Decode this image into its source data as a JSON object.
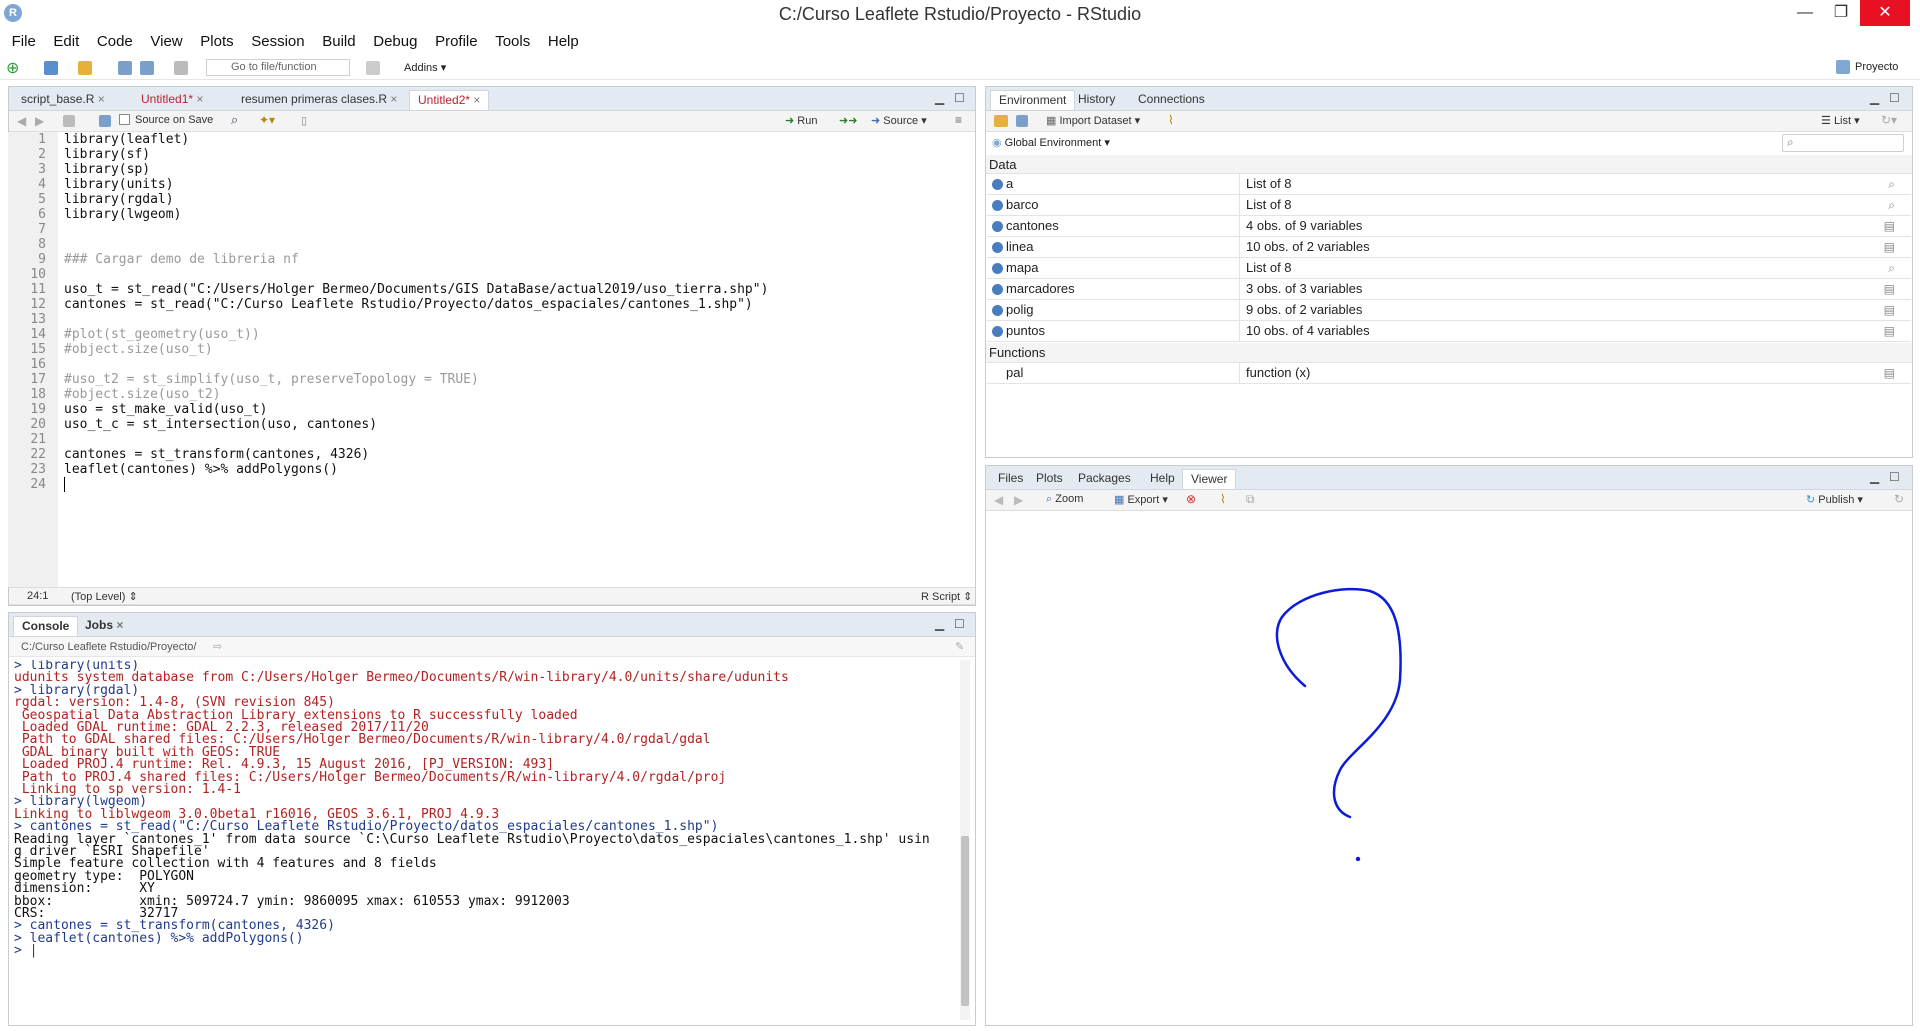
{
  "window": {
    "title": "C:/Curso Leaflete Rstudio/Proyecto - RStudio",
    "logo": "R",
    "min": "—",
    "max": "❐",
    "close": "✕"
  },
  "menu": [
    "File",
    "Edit",
    "Code",
    "View",
    "Plots",
    "Session",
    "Build",
    "Debug",
    "Profile",
    "Tools",
    "Help"
  ],
  "toolbar": {
    "goto_placeholder": "Go to file/function",
    "addins": "Addins",
    "project": "Proyecto"
  },
  "editor": {
    "tabs": [
      "script_base.R",
      "Untitled1*",
      "resumen primeras clases.R",
      "Untitled2*"
    ],
    "source_on_save": "Source on Save",
    "run": "Run",
    "source": "Source",
    "lines": [
      {
        "n": "1",
        "t": "library(leaflet)",
        "k": "code"
      },
      {
        "n": "2",
        "t": "library(sf)",
        "k": "code"
      },
      {
        "n": "3",
        "t": "library(sp)",
        "k": "code"
      },
      {
        "n": "4",
        "t": "library(units)",
        "k": "code"
      },
      {
        "n": "5",
        "t": "library(rgdal)",
        "k": "code"
      },
      {
        "n": "6",
        "t": "library(lwgeom)",
        "k": "code"
      },
      {
        "n": "7",
        "t": "",
        "k": "code"
      },
      {
        "n": "8",
        "t": "",
        "k": "code"
      },
      {
        "n": "9",
        "t": "### Cargar demo de libreria nf",
        "k": "cmt"
      },
      {
        "n": "10",
        "t": "",
        "k": "code"
      },
      {
        "n": "11",
        "t": "uso_t = st_read(\"C:/Users/Holger Bermeo/Documents/GIS DataBase/actual2019/uso_tierra.shp\")",
        "k": "code"
      },
      {
        "n": "12",
        "t": "cantones = st_read(\"C:/Curso Leaflete Rstudio/Proyecto/datos_espaciales/cantones_1.shp\")",
        "k": "code"
      },
      {
        "n": "13",
        "t": "",
        "k": "code"
      },
      {
        "n": "14",
        "t": "#plot(st_geometry(uso_t))",
        "k": "cmt"
      },
      {
        "n": "15",
        "t": "#object.size(uso_t)",
        "k": "cmt"
      },
      {
        "n": "16",
        "t": "",
        "k": "code"
      },
      {
        "n": "17",
        "t": "#uso_t2 = st_simplify(uso_t, preserveTopology = TRUE)",
        "k": "cmt"
      },
      {
        "n": "18",
        "t": "#object.size(uso_t2)",
        "k": "cmt"
      },
      {
        "n": "19",
        "t": "uso = st_make_valid(uso_t)",
        "k": "code"
      },
      {
        "n": "20",
        "t": "uso_t_c = st_intersection(uso, cantones)",
        "k": "code"
      },
      {
        "n": "21",
        "t": "",
        "k": "code"
      },
      {
        "n": "22",
        "t": "cantones = st_transform(cantones, 4326)",
        "k": "code"
      },
      {
        "n": "23",
        "t": "leaflet(cantones) %>% addPolygons()",
        "k": "code"
      },
      {
        "n": "24",
        "t": "",
        "k": "code"
      }
    ],
    "status_pos": "24:1",
    "status_scope": "(Top Level)",
    "status_type": "R Script"
  },
  "console": {
    "tabs": [
      "Console",
      "Jobs"
    ],
    "path": "C:/Curso Leaflete Rstudio/Proyecto/",
    "lines": [
      {
        "t": "> library(units)",
        "k": "in"
      },
      {
        "t": "udunits system database from C:/Users/Holger Bermeo/Documents/R/win-library/4.0/units/share/udunits",
        "k": "msg"
      },
      {
        "t": "> library(rgdal)",
        "k": "in"
      },
      {
        "t": "rgdal: version: 1.4-8, (SVN revision 845)",
        "k": "msg"
      },
      {
        "t": " Geospatial Data Abstraction Library extensions to R successfully loaded",
        "k": "msg"
      },
      {
        "t": " Loaded GDAL runtime: GDAL 2.2.3, released 2017/11/20",
        "k": "msg"
      },
      {
        "t": " Path to GDAL shared files: C:/Users/Holger Bermeo/Documents/R/win-library/4.0/rgdal/gdal",
        "k": "msg"
      },
      {
        "t": " GDAL binary built with GEOS: TRUE",
        "k": "msg"
      },
      {
        "t": " Loaded PROJ.4 runtime: Rel. 4.9.3, 15 August 2016, [PJ_VERSION: 493]",
        "k": "msg"
      },
      {
        "t": " Path to PROJ.4 shared files: C:/Users/Holger Bermeo/Documents/R/win-library/4.0/rgdal/proj",
        "k": "msg"
      },
      {
        "t": " Linking to sp version: 1.4-1",
        "k": "msg"
      },
      {
        "t": "> library(lwgeom)",
        "k": "in"
      },
      {
        "t": "Linking to liblwgeom 3.0.0beta1 r16016, GEOS 3.6.1, PROJ 4.9.3",
        "k": "msg"
      },
      {
        "t": "> cantones = st_read(\"C:/Curso Leaflete Rstudio/Proyecto/datos_espaciales/cantones_1.shp\")",
        "k": "in"
      },
      {
        "t": "Reading layer `cantones_1' from data source `C:\\Curso Leaflete Rstudio\\Proyecto\\datos_espaciales\\cantones_1.shp' usin",
        "k": "out"
      },
      {
        "t": "g driver `ESRI Shapefile'",
        "k": "out"
      },
      {
        "t": "Simple feature collection with 4 features and 8 fields",
        "k": "out"
      },
      {
        "t": "geometry type:  POLYGON",
        "k": "out"
      },
      {
        "t": "dimension:      XY",
        "k": "out"
      },
      {
        "t": "bbox:           xmin: 509724.7 ymin: 9860095 xmax: 610553 ymax: 9912003",
        "k": "out"
      },
      {
        "t": "CRS:            32717",
        "k": "out"
      },
      {
        "t": "> cantones = st_transform(cantones, 4326)",
        "k": "in"
      },
      {
        "t": "> leaflet(cantones) %>% addPolygons()",
        "k": "in"
      },
      {
        "t": "> |",
        "k": "in"
      }
    ]
  },
  "environment": {
    "tabs": [
      "Environment",
      "History",
      "Connections"
    ],
    "import_dataset": "Import Dataset",
    "list_mode": "List",
    "scope": "Global Environment",
    "section_data": "Data",
    "section_functions": "Functions",
    "data": [
      {
        "name": "a",
        "value": "List of 8",
        "icon": "magnifier-icon"
      },
      {
        "name": "barco",
        "value": "List of 8",
        "icon": "magnifier-icon"
      },
      {
        "name": "cantones",
        "value": "4 obs. of 9 variables",
        "icon": "grid-icon"
      },
      {
        "name": "linea",
        "value": "10 obs. of 2 variables",
        "icon": "grid-icon"
      },
      {
        "name": "mapa",
        "value": "List of 8",
        "icon": "magnifier-icon"
      },
      {
        "name": "marcadores",
        "value": "3 obs. of 3 variables",
        "icon": "grid-icon"
      },
      {
        "name": "polig",
        "value": "9 obs. of 2 variables",
        "icon": "grid-icon"
      },
      {
        "name": "puntos",
        "value": "10 obs. of 4 variables",
        "icon": "grid-icon"
      }
    ],
    "functions": [
      {
        "name": "pal",
        "value": "function (x)"
      }
    ]
  },
  "viewer": {
    "tabs": [
      "Files",
      "Plots",
      "Packages",
      "Help",
      "Viewer"
    ],
    "zoom": "Zoom",
    "export": "Export",
    "publish": "Publish"
  },
  "colors": {
    "pane_header": "#e4eaf1",
    "accent": "#4a7dbe",
    "close_red": "#e81123",
    "drawing_blue": "#0b1bd6"
  }
}
